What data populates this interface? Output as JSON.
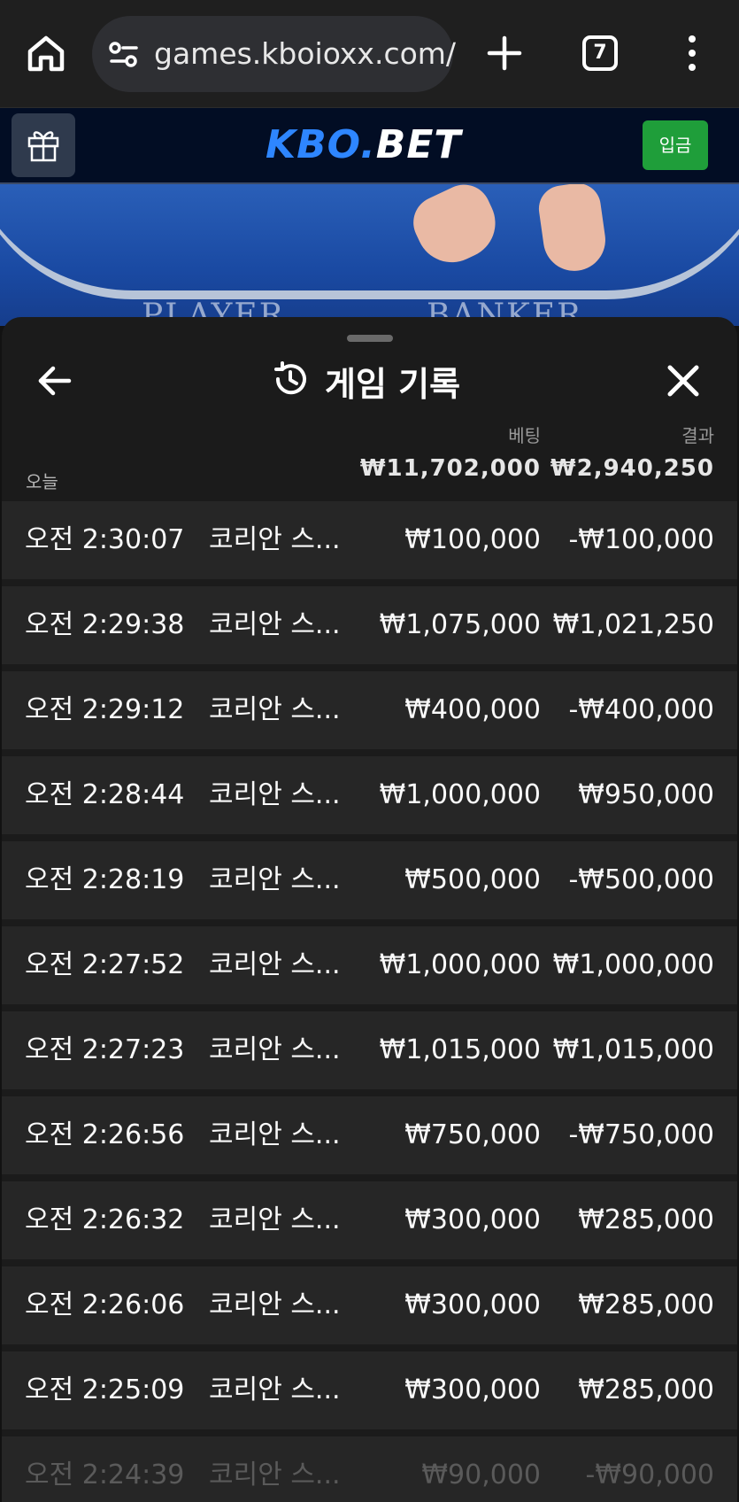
{
  "browser": {
    "url": "games.kboioxx.com/",
    "tab_count": "7"
  },
  "site": {
    "logo_a": "KBO.",
    "logo_b": "BET",
    "deposit_label": "입금"
  },
  "felt": {
    "player": "PLAYER",
    "banker": "BANKER"
  },
  "sheet": {
    "title": "게임 기록",
    "col_bet": "베팅",
    "col_result": "결과",
    "today_label": "오늘",
    "total_bet": "₩11,702,000",
    "total_result": "₩2,940,250"
  },
  "rows": [
    {
      "time": "오전 2:30:07",
      "game": "코리안 스...",
      "bet": "₩100,000",
      "result": "-₩100,000"
    },
    {
      "time": "오전 2:29:38",
      "game": "코리안 스...",
      "bet": "₩1,075,000",
      "result": "₩1,021,250"
    },
    {
      "time": "오전 2:29:12",
      "game": "코리안 스...",
      "bet": "₩400,000",
      "result": "-₩400,000"
    },
    {
      "time": "오전 2:28:44",
      "game": "코리안 스...",
      "bet": "₩1,000,000",
      "result": "₩950,000"
    },
    {
      "time": "오전 2:28:19",
      "game": "코리안 스...",
      "bet": "₩500,000",
      "result": "-₩500,000"
    },
    {
      "time": "오전 2:27:52",
      "game": "코리안 스...",
      "bet": "₩1,000,000",
      "result": "₩1,000,000"
    },
    {
      "time": "오전 2:27:23",
      "game": "코리안 스...",
      "bet": "₩1,015,000",
      "result": "₩1,015,000"
    },
    {
      "time": "오전 2:26:56",
      "game": "코리안 스...",
      "bet": "₩750,000",
      "result": "-₩750,000"
    },
    {
      "time": "오전 2:26:32",
      "game": "코리안 스...",
      "bet": "₩300,000",
      "result": "₩285,000"
    },
    {
      "time": "오전 2:26:06",
      "game": "코리안 스...",
      "bet": "₩300,000",
      "result": "₩285,000"
    },
    {
      "time": "오전 2:25:09",
      "game": "코리안 스...",
      "bet": "₩300,000",
      "result": "₩285,000"
    },
    {
      "time": "오전 2:24:39",
      "game": "코리안 스...",
      "bet": "₩90,000",
      "result": "-₩90,000"
    }
  ]
}
